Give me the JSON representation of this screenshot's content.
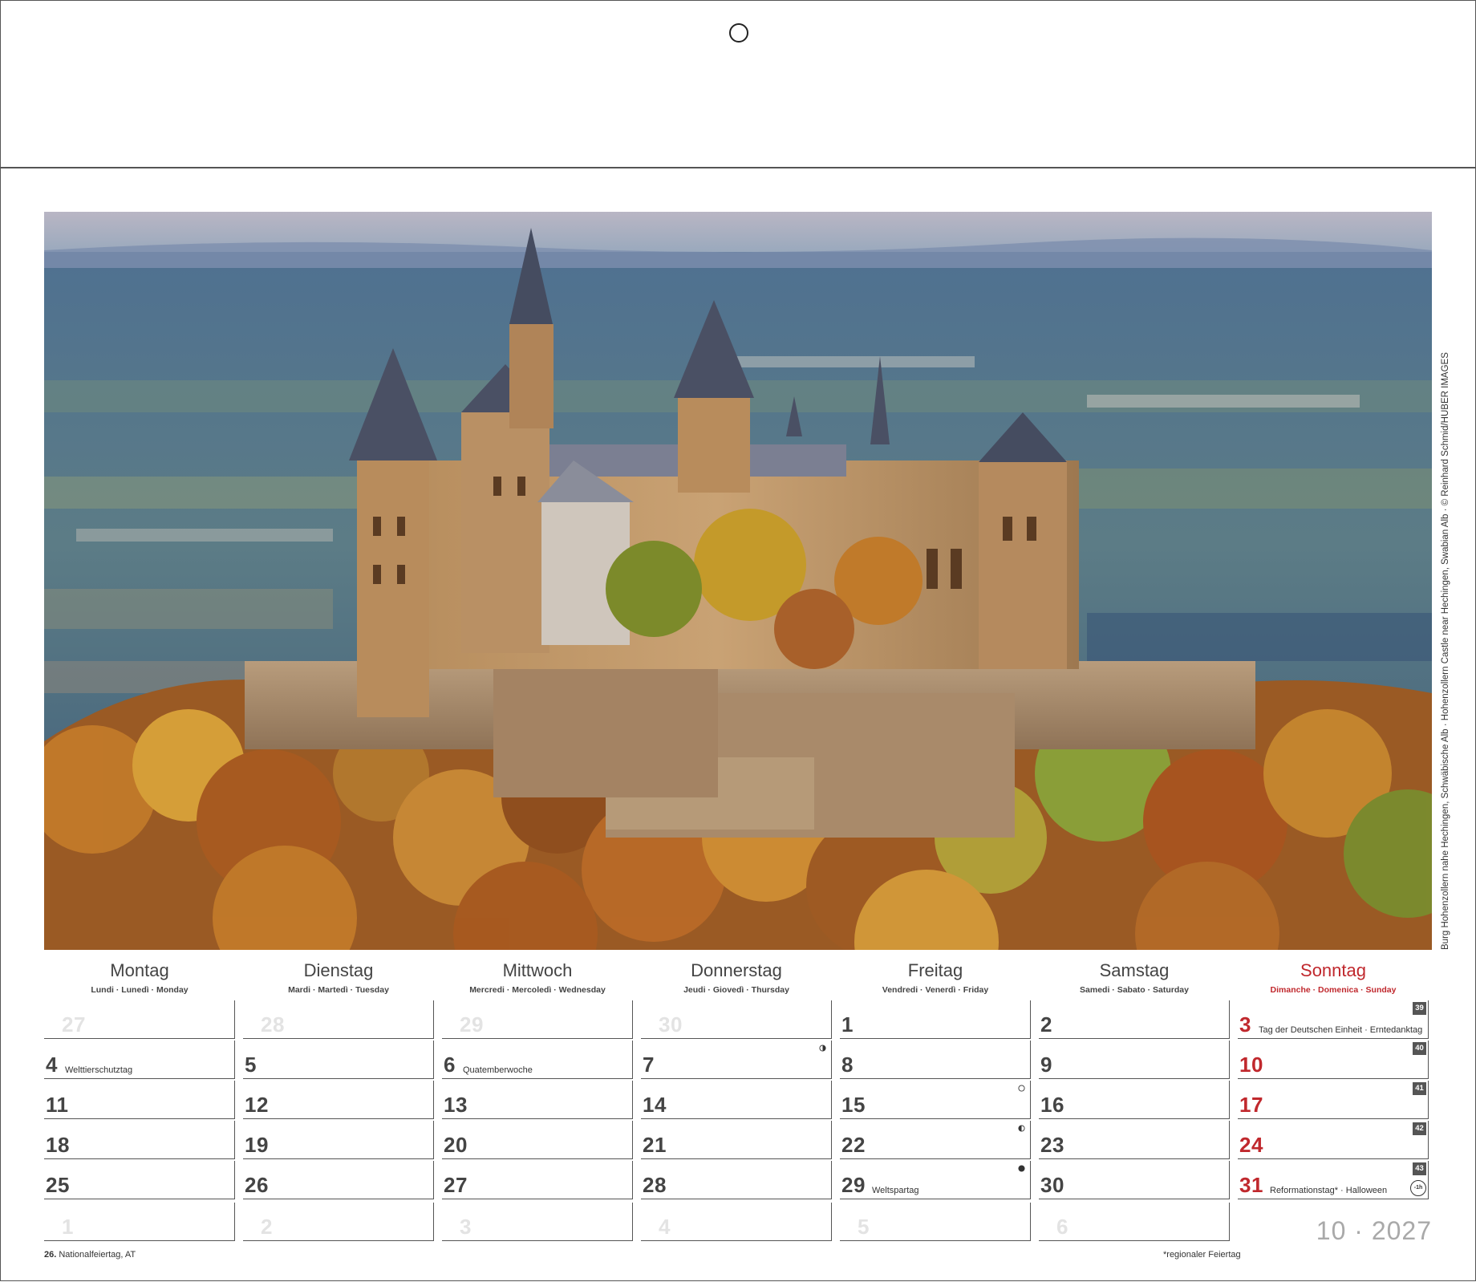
{
  "photo": {
    "credit": "Burg Hohenzollern nahe Hechingen, Schwäbische Alb · Hohenzollern Castle near Hechingen, Swabian Alb · © Reinhard Schmid/HUBER IMAGES"
  },
  "weekdays": [
    {
      "name": "Montag",
      "sub": "Lundi · Lunedì · Monday"
    },
    {
      "name": "Dienstag",
      "sub": "Mardi · Martedì · Tuesday"
    },
    {
      "name": "Mittwoch",
      "sub": "Mercredi · Mercoledì · Wednesday"
    },
    {
      "name": "Donnerstag",
      "sub": "Jeudi · Giovedì · Thursday"
    },
    {
      "name": "Freitag",
      "sub": "Vendredi · Venerdì · Friday"
    },
    {
      "name": "Samstag",
      "sub": "Samedi · Sabato · Saturday"
    },
    {
      "name": "Sonntag",
      "sub": "Dimanche · Domenica · Sunday"
    }
  ],
  "weeks": [
    {
      "kw": "39",
      "days": [
        {
          "n": "27",
          "other": true
        },
        {
          "n": "28",
          "other": true
        },
        {
          "n": "29",
          "other": true
        },
        {
          "n": "30",
          "other": true
        },
        {
          "n": "1"
        },
        {
          "n": "2"
        },
        {
          "n": "3",
          "note": "Tag der Deutschen Einheit · Erntedanktag"
        }
      ]
    },
    {
      "kw": "40",
      "days": [
        {
          "n": "4",
          "note": "Welttierschutztag"
        },
        {
          "n": "5"
        },
        {
          "n": "6",
          "note": "Quatemberwoche"
        },
        {
          "n": "7",
          "moon": "first"
        },
        {
          "n": "8"
        },
        {
          "n": "9"
        },
        {
          "n": "10"
        }
      ]
    },
    {
      "kw": "41",
      "days": [
        {
          "n": "11"
        },
        {
          "n": "12"
        },
        {
          "n": "13"
        },
        {
          "n": "14"
        },
        {
          "n": "15",
          "moon": "full"
        },
        {
          "n": "16"
        },
        {
          "n": "17"
        }
      ]
    },
    {
      "kw": "42",
      "days": [
        {
          "n": "18"
        },
        {
          "n": "19"
        },
        {
          "n": "20"
        },
        {
          "n": "21"
        },
        {
          "n": "22",
          "moon": "last"
        },
        {
          "n": "23"
        },
        {
          "n": "24"
        }
      ]
    },
    {
      "kw": "43",
      "days": [
        {
          "n": "25"
        },
        {
          "n": "26"
        },
        {
          "n": "27"
        },
        {
          "n": "28"
        },
        {
          "n": "29",
          "note": "Weltspartag",
          "moon": "new"
        },
        {
          "n": "30"
        },
        {
          "n": "31",
          "note": "Reformationstag* · Halloween",
          "clock": "-1h"
        }
      ]
    },
    {
      "days": [
        {
          "n": "1",
          "other": true
        },
        {
          "n": "2",
          "other": true
        },
        {
          "n": "3",
          "other": true
        },
        {
          "n": "4",
          "other": true
        },
        {
          "n": "5",
          "other": true
        },
        {
          "n": "6",
          "other": true
        }
      ]
    }
  ],
  "month_year": "10 · 2027",
  "footer": {
    "left_bold": "26.",
    "left_text": "Nationalfeiertag, AT",
    "right_text": "*regionaler Feiertag"
  },
  "colors": {
    "sunday": "#c0282d",
    "grid": "#555555",
    "other_month": "#e3e3e3"
  }
}
